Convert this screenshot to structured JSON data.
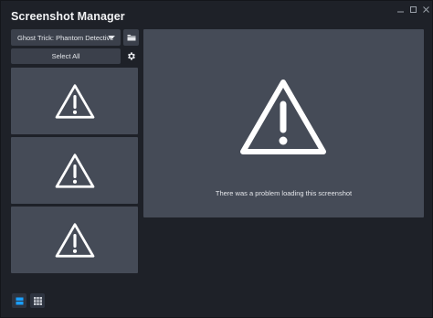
{
  "window": {
    "title": "Screenshot Manager",
    "controls": [
      "minimize-icon",
      "maximize-icon",
      "close-icon"
    ]
  },
  "toolbar": {
    "game_selected": "Ghost Trick: Phantom Detective",
    "folder_icon": "folder-icon",
    "select_all_label": "Select All",
    "settings_icon": "gear-icon"
  },
  "thumbnails": [
    {
      "icon": "warning-icon"
    },
    {
      "icon": "warning-icon"
    },
    {
      "icon": "warning-icon"
    }
  ],
  "preview": {
    "icon": "warning-icon",
    "message": "There was a problem loading this screenshot"
  },
  "view_modes": [
    {
      "name": "list-view",
      "active": true
    },
    {
      "name": "grid-view",
      "active": false
    }
  ],
  "colors": {
    "background": "#1e2128",
    "panel": "#454b57",
    "button": "#3b404b",
    "accent": "#1a9fff",
    "text": "#e4e6ea"
  }
}
